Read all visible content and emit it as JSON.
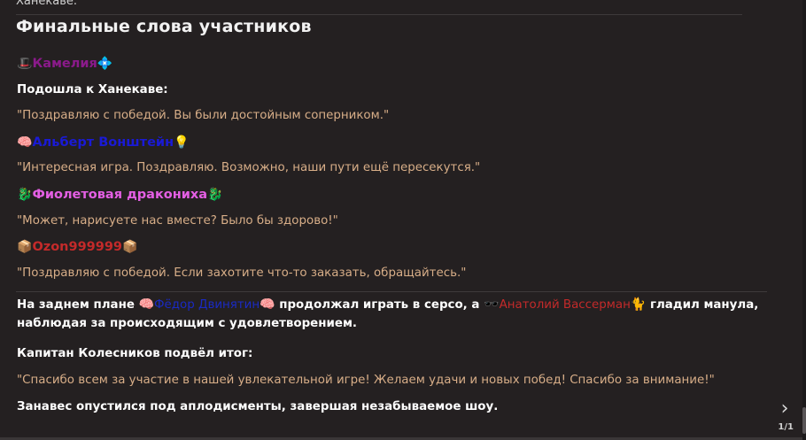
{
  "title": "Финальные слова участников",
  "participants": [
    {
      "emoji_left": "🎩",
      "name": "Камелия",
      "emoji_right": "💠",
      "color": "#8b1a8b"
    },
    {
      "emoji_left": "🧠",
      "name": "Альберт Вонштейн",
      "emoji_right": "💡",
      "color": "#1a1ad6"
    },
    {
      "emoji_left": "🐉",
      "name": "Фиолетовая дракониха",
      "emoji_right": "🐉",
      "color": "#e45fe4"
    },
    {
      "emoji_left": "📦",
      "name": "Ozon999999",
      "emoji_right": "📦",
      "color": "#c42a2a"
    }
  ],
  "lines": {
    "kamelia_action": "Подошла к Ханекаве:",
    "kamelia_quote": "\"Поздравляю с победой. Вы были достойным соперником.\"",
    "albert_quote": "\"Интересная игра. Поздравляю. Возможно, наши пути ещё пересекутся.\"",
    "dragon_quote": "\"Может, нарисуете нас вместе? Было бы здорово!\"",
    "ozon_quote": "\"Поздравляю с победой. Если захотите что-то заказать, обращайтесь.\""
  },
  "narration": {
    "part1": "На заднем плане ",
    "emoji_fedor_left": "🧠",
    "fedor": "Фёдор Двинятин",
    "emoji_fedor_right": "🧠",
    "part2": " продолжал играть в серсо, а ",
    "emoji_anatoly": "🕶️",
    "anatoly": "Анатолий Вассерман",
    "emoji_cat": "🐈",
    "part3": " гладил манула, наблюдая за происходящим с удовлетворением."
  },
  "captain_label": "Капитан Колесников подвёл итог:",
  "captain_quote": "\"Спасибо всем за участие в нашей увлекательной игре! Желаем удачи и новых побед! Спасибо за внимание!\"",
  "closing": "Занавес опустился под аплодисменты, завершая незабываемое шоу.",
  "pager": "1/1",
  "next_icon": "chevron-right-icon",
  "clipped_top_text": "Ханекаве."
}
